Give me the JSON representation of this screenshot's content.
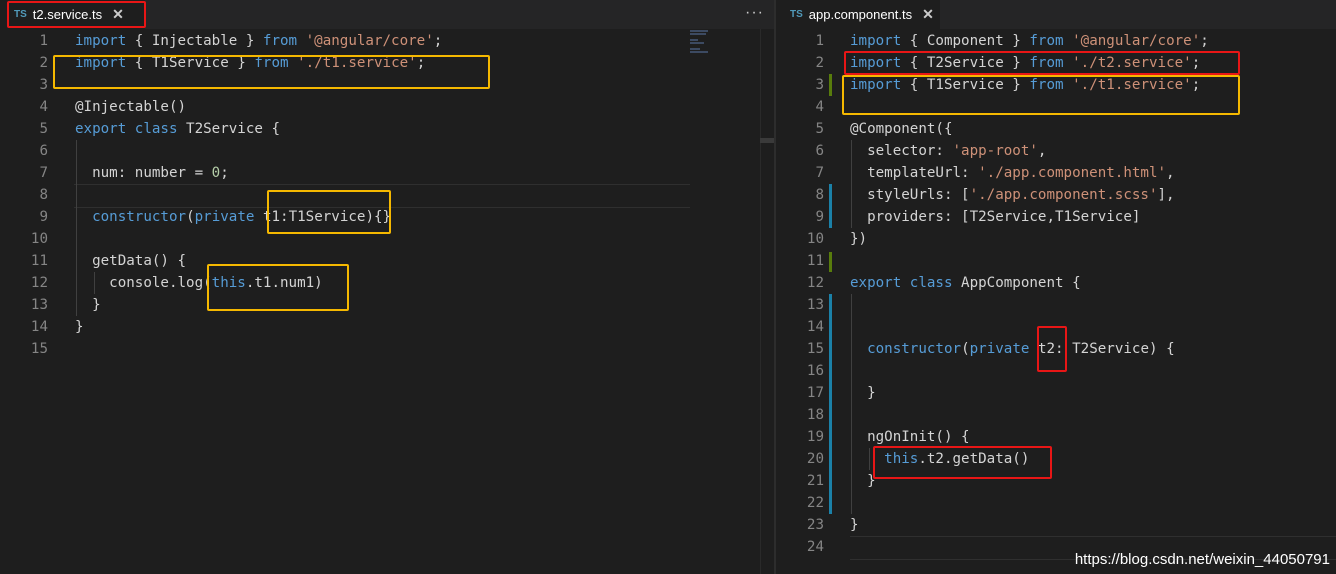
{
  "left": {
    "tab": {
      "badge": "TS",
      "title": "t2.service.ts",
      "close": "✕"
    },
    "more": "···",
    "lines": [
      [
        [
          "kw",
          "import"
        ],
        [
          "",
          "{ Injectable } "
        ],
        [
          "kw",
          "from"
        ],
        [
          "",
          ""
        ],
        [
          "str",
          "'@angular/core'"
        ],
        [
          "",
          ";"
        ]
      ],
      [
        [
          "kw",
          "import"
        ],
        [
          "",
          "{ T1Service } "
        ],
        [
          "kw",
          "from"
        ],
        [
          "str",
          "'./t1.service'"
        ],
        [
          "",
          ";"
        ]
      ],
      [],
      [
        [
          "",
          "@Injectable()"
        ]
      ],
      [
        [
          "kw",
          "export"
        ],
        [
          "",
          ""
        ],
        [
          "kw",
          "class"
        ],
        [
          "",
          " T2Service {"
        ]
      ],
      [],
      [
        [
          "",
          "  num: number = "
        ],
        [
          "num",
          "0"
        ],
        [
          "",
          ";"
        ]
      ],
      [],
      [
        [
          "",
          "  "
        ],
        [
          "kw",
          "constructor"
        ],
        [
          "",
          "("
        ],
        [
          "kw",
          "private"
        ],
        [
          "",
          " t1:T1Service){}"
        ]
      ],
      [],
      [
        [
          "",
          "  getData() {"
        ]
      ],
      [
        [
          "",
          "    console.log("
        ],
        [
          "kw",
          "this"
        ],
        [
          "",
          ".t1.num1)"
        ]
      ],
      [
        [
          "",
          "  }"
        ]
      ],
      [
        [
          "",
          "}"
        ]
      ],
      []
    ]
  },
  "right": {
    "tab": {
      "badge": "TS",
      "title": "app.component.ts",
      "close": "✕"
    },
    "lines": [
      [
        [
          "kw",
          "import"
        ],
        [
          "",
          "{ Component } "
        ],
        [
          "kw",
          "from"
        ],
        [
          "",
          ""
        ],
        [
          "str",
          "'@angular/core'"
        ],
        [
          "",
          ";"
        ]
      ],
      [
        [
          "kw",
          "import"
        ],
        [
          "",
          "{ T2Service } "
        ],
        [
          "kw",
          "from"
        ],
        [
          "str",
          "'./t2.service'"
        ],
        [
          "",
          ";"
        ]
      ],
      [
        [
          "kw",
          "import"
        ],
        [
          "",
          "{ T1Service } "
        ],
        [
          "kw",
          "from"
        ],
        [
          "str",
          "'./t1.service'"
        ],
        [
          "",
          ";"
        ]
      ],
      [],
      [
        [
          "",
          "@Component({"
        ]
      ],
      [
        [
          "",
          "  selector: "
        ],
        [
          "str",
          "'app-root'"
        ],
        [
          "",
          ","
        ]
      ],
      [
        [
          "",
          "  templateUrl: "
        ],
        [
          "str",
          "'./app.component.html'"
        ],
        [
          "",
          ","
        ]
      ],
      [
        [
          "",
          "  styleUrls: ["
        ],
        [
          "str",
          "'./app.component.scss'"
        ],
        [
          "",
          "],"
        ]
      ],
      [
        [
          "",
          "  providers: [T2Service,T1Service]"
        ]
      ],
      [
        [
          "",
          "})"
        ]
      ],
      [],
      [
        [
          "kw",
          "export"
        ],
        [
          "",
          ""
        ],
        [
          "kw",
          "class"
        ],
        [
          "",
          " AppComponent {"
        ]
      ],
      [],
      [],
      [
        [
          "",
          "  "
        ],
        [
          "kw",
          "constructor"
        ],
        [
          "",
          "("
        ],
        [
          "kw",
          "private"
        ],
        [
          "",
          " t2: T2Service) {"
        ]
      ],
      [],
      [
        [
          "",
          "  }"
        ]
      ],
      [],
      [
        [
          "",
          "  ngOnInit() {"
        ]
      ],
      [
        [
          "",
          "    "
        ],
        [
          "kw",
          "this"
        ],
        [
          "",
          ".t2.getData()"
        ]
      ],
      [
        [
          "",
          "  }"
        ]
      ],
      [],
      [
        [
          "",
          "}"
        ]
      ],
      []
    ]
  },
  "watermark": "https://blog.csdn.net/weixin_44050791",
  "colors": {
    "keyword": "#569cd6",
    "string": "#ce9178",
    "number": "#b5cea8",
    "text": "#d4d4d4",
    "highlight_yellow": "#f5b800",
    "highlight_red": "#e81616"
  }
}
